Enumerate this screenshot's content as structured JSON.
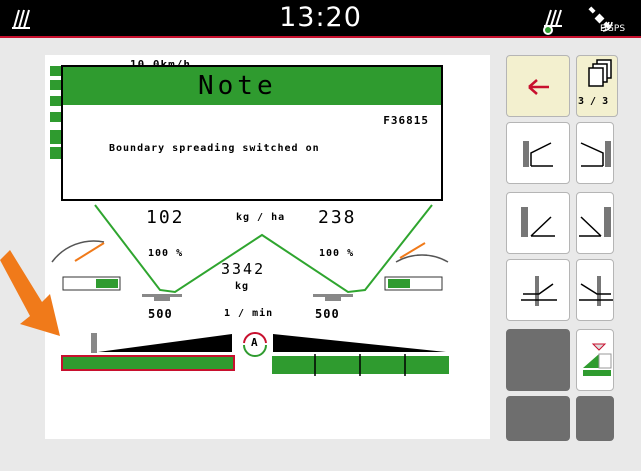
{
  "status_bar": {
    "time": "13:20",
    "gps_label": "DGPS",
    "icons": [
      "menu-icon",
      "signal-strength-icon",
      "satellite-gps-icon"
    ]
  },
  "note_dialog": {
    "title": "Note",
    "code": "F36815",
    "message": "Boundary spreading switched on"
  },
  "spreader": {
    "left_rate": "102",
    "rate_unit": "kg / ha",
    "right_rate": "238",
    "left_percent": "100 %",
    "right_percent": "100 %",
    "total_amount": "3342",
    "amount_unit": "kg",
    "left_rpm": "500",
    "rpm_unit": "1 / min",
    "right_rpm": "500",
    "mode_label": "A",
    "header_partial": "10.0km/h"
  },
  "side_buttons": {
    "page_indicator": "3 / 3",
    "icons": [
      "back-arrow-icon",
      "page-switch-icon",
      "boundary-left-icon",
      "boundary-right-icon",
      "border-left-icon",
      "border-right-icon",
      "ditch-left-icon",
      "ditch-right-icon",
      "boundary-spreading-mode-icon"
    ]
  },
  "colors": {
    "accent_green": "#2f9b2f",
    "alert_orange": "#f07a1a",
    "back_arrow_red": "#c8102e",
    "disabled_button": "#6e6e6e",
    "highlight_button": "#f3f0cf"
  }
}
